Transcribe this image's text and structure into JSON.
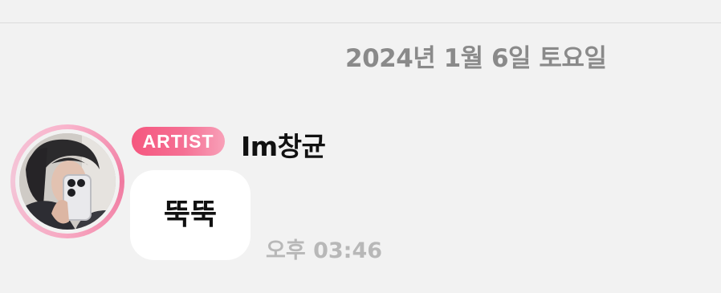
{
  "chat": {
    "date_header": "2024년 1월 6일 토요일"
  },
  "message": {
    "badge": "ARTIST",
    "sender": "Im창균",
    "text": "뚝뚝",
    "time": "오후 03:46"
  },
  "colors": {
    "background": "#f2f2f2",
    "badge_gradient_start": "#f5577f",
    "badge_gradient_end": "#f8a0b8",
    "avatar_ring": "#f07aa0",
    "bubble": "#ffffff",
    "date_text": "#8a8a8a",
    "time_text": "#b8b8b8"
  },
  "icons": {
    "avatar": "avatar-photo"
  }
}
